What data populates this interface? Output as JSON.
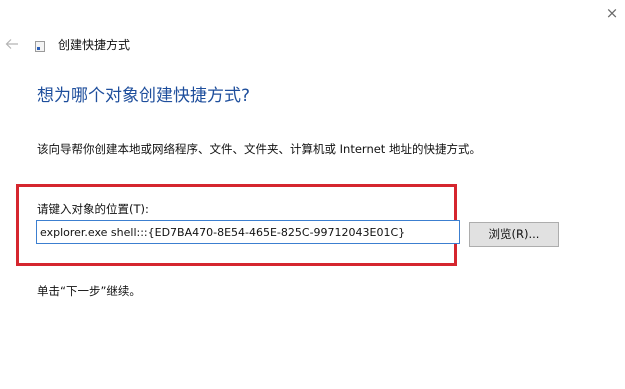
{
  "window": {
    "title": "创建快捷方式",
    "close_glyph": "×",
    "back_icon": "arrow-left-icon",
    "title_icon": "shortcut-icon"
  },
  "main": {
    "heading": "想为哪个对象创建快捷方式?",
    "description": "该向导帮你创建本地或网络程序、文件、文件夹、计算机或 Internet 地址的快捷方式。",
    "field_label": "请键入对象的位置(T):",
    "location_value": "explorer.exe shell:::{ED7BA470-8E54-465E-825C-99712043E01C}",
    "browse_label": "浏览(R)...",
    "hint": "单击“下一步”继续。"
  },
  "colors": {
    "heading": "#1e4e9c",
    "highlight_border": "#d5262e",
    "input_border": "#3c7fd0",
    "button_bg": "#e1e1e1"
  }
}
